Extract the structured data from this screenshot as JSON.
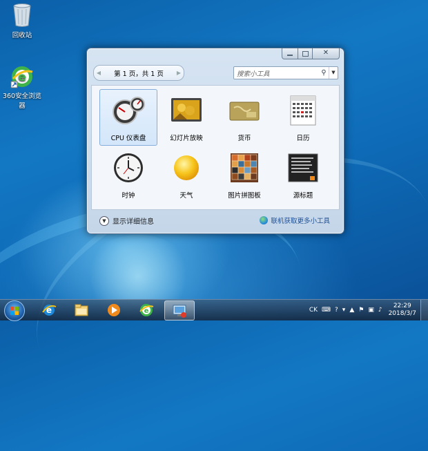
{
  "desktop": {
    "recycle_bin": {
      "label": "回收站",
      "icon": "recycle-bin-icon"
    },
    "browser": {
      "label": "360安全浏览器",
      "icon": "browser-360-icon"
    }
  },
  "gadgets_window": {
    "pager_text": "第 1 页，共 1 页",
    "search_placeholder": "搜索小工具",
    "gadgets": [
      {
        "label": "CPU 仪表盘",
        "icon": "cpu-meter-icon",
        "selected": true
      },
      {
        "label": "幻灯片放映",
        "icon": "slideshow-icon"
      },
      {
        "label": "货币",
        "icon": "currency-icon"
      },
      {
        "label": "日历",
        "icon": "calendar-icon"
      },
      {
        "label": "时钟",
        "icon": "clock-icon"
      },
      {
        "label": "天气",
        "icon": "weather-icon"
      },
      {
        "label": "图片拼图板",
        "icon": "picture-puzzle-icon"
      },
      {
        "label": "源标题",
        "icon": "feed-headlines-icon"
      }
    ],
    "details_label": "显示详细信息",
    "online_link": "联机获取更多小工具"
  },
  "taskbar": {
    "pinned": [
      "internet-explorer-icon",
      "file-explorer-icon",
      "media-player-icon",
      "browser-360-icon",
      "gadgets-icon"
    ],
    "tray_lang": "CK",
    "time": "22:29",
    "date": "2018/3/7"
  },
  "colors": {
    "accent": "#1378c4",
    "link": "#1e4f95",
    "selection": "#d3e6fa"
  }
}
